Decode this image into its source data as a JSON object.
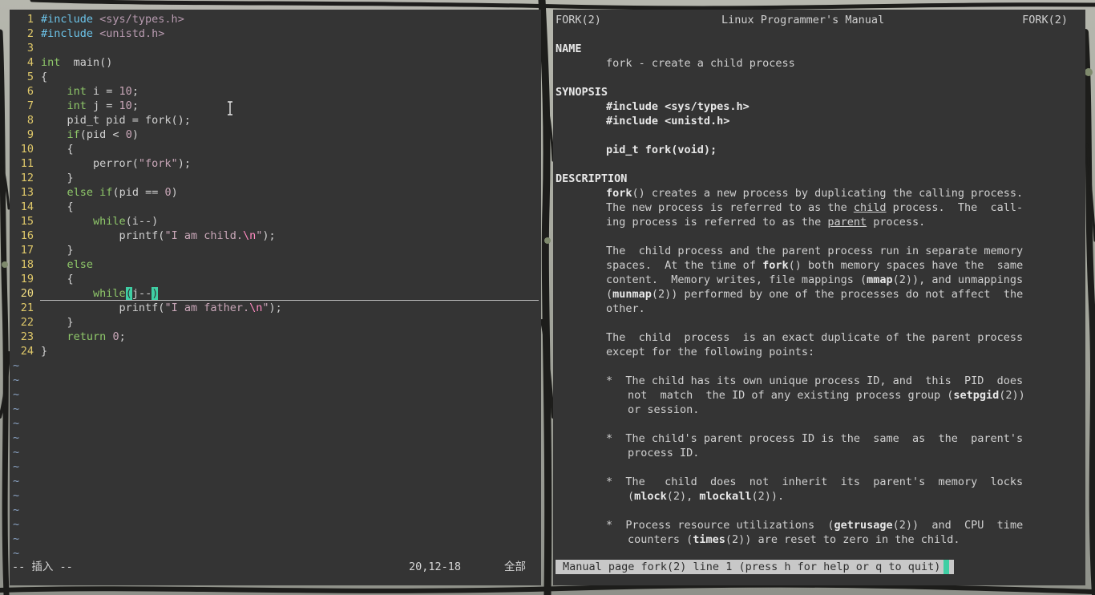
{
  "editor": {
    "lines": [
      {
        "n": "1",
        "segs": [
          [
            "pp",
            "#include "
          ],
          [
            "inc",
            "<sys/types.h>"
          ]
        ]
      },
      {
        "n": "2",
        "segs": [
          [
            "pp",
            "#include "
          ],
          [
            "inc",
            "<unistd.h>"
          ]
        ]
      },
      {
        "n": "3",
        "segs": []
      },
      {
        "n": "4",
        "segs": [
          [
            "k",
            "int"
          ],
          [
            "",
            "  main()"
          ]
        ]
      },
      {
        "n": "5",
        "segs": [
          [
            "",
            "{"
          ]
        ]
      },
      {
        "n": "6",
        "segs": [
          [
            "",
            "    "
          ],
          [
            "k",
            "int"
          ],
          [
            "",
            " i = "
          ],
          [
            "n",
            "10"
          ],
          [
            "",
            ";"
          ]
        ]
      },
      {
        "n": "7",
        "segs": [
          [
            "",
            "    "
          ],
          [
            "k",
            "int"
          ],
          [
            "",
            " j = "
          ],
          [
            "n",
            "10"
          ],
          [
            "",
            ";"
          ]
        ]
      },
      {
        "n": "8",
        "segs": [
          [
            "",
            "    pid_t pid = fork();"
          ]
        ]
      },
      {
        "n": "9",
        "segs": [
          [
            "",
            "    "
          ],
          [
            "k",
            "if"
          ],
          [
            "",
            "(pid < "
          ],
          [
            "n",
            "0"
          ],
          [
            "",
            ")"
          ]
        ]
      },
      {
        "n": "10",
        "segs": [
          [
            "",
            "    {"
          ]
        ]
      },
      {
        "n": "11",
        "segs": [
          [
            "",
            "        perror("
          ],
          [
            "s",
            "\"fork\""
          ],
          [
            "",
            ");"
          ]
        ]
      },
      {
        "n": "12",
        "segs": [
          [
            "",
            "    }"
          ]
        ]
      },
      {
        "n": "13",
        "segs": [
          [
            "",
            "    "
          ],
          [
            "k",
            "else"
          ],
          [
            "",
            " "
          ],
          [
            "k",
            "if"
          ],
          [
            "",
            "(pid == "
          ],
          [
            "n",
            "0"
          ],
          [
            "",
            ")"
          ]
        ]
      },
      {
        "n": "14",
        "segs": [
          [
            "",
            "    {"
          ]
        ]
      },
      {
        "n": "15",
        "segs": [
          [
            "",
            "        "
          ],
          [
            "k",
            "while"
          ],
          [
            "",
            "(i--)"
          ]
        ]
      },
      {
        "n": "16",
        "segs": [
          [
            "",
            "            printf("
          ],
          [
            "s",
            "\"I am child."
          ],
          [
            "esc",
            "\\n"
          ],
          [
            "s",
            "\""
          ],
          [
            "",
            ");"
          ]
        ]
      },
      {
        "n": "17",
        "segs": [
          [
            "",
            "    }"
          ]
        ]
      },
      {
        "n": "18",
        "segs": [
          [
            "",
            "    "
          ],
          [
            "k",
            "else"
          ]
        ]
      },
      {
        "n": "19",
        "segs": [
          [
            "",
            "    {"
          ]
        ]
      },
      {
        "n": "20",
        "segs": [
          [
            "",
            "        "
          ],
          [
            "k",
            "while"
          ],
          [
            "blk",
            "("
          ],
          [
            "",
            "j--"
          ],
          [
            "blk",
            ")"
          ]
        ]
      },
      {
        "n": "21",
        "segs": [
          [
            "",
            "            printf("
          ],
          [
            "s",
            "\"I am father."
          ],
          [
            "esc",
            "\\n"
          ],
          [
            "s",
            "\""
          ],
          [
            "",
            ");"
          ]
        ]
      },
      {
        "n": "22",
        "segs": [
          [
            "",
            "    }"
          ]
        ]
      },
      {
        "n": "23",
        "segs": [
          [
            "",
            "    "
          ],
          [
            "k",
            "return"
          ],
          [
            "",
            " "
          ],
          [
            "n",
            "0"
          ],
          [
            "",
            ";"
          ]
        ]
      },
      {
        "n": "24",
        "segs": [
          [
            "",
            "}"
          ]
        ]
      }
    ],
    "tilde": "~",
    "mode": "-- 插入 --",
    "position": "20,12-18",
    "scroll": "全部"
  },
  "man": {
    "header_left": "FORK(2)",
    "header_center": "Linux Programmer's Manual",
    "header_right": "FORK(2)",
    "status": "Manual page fork(2) line 1 (press h for help or q to quit)"
  }
}
